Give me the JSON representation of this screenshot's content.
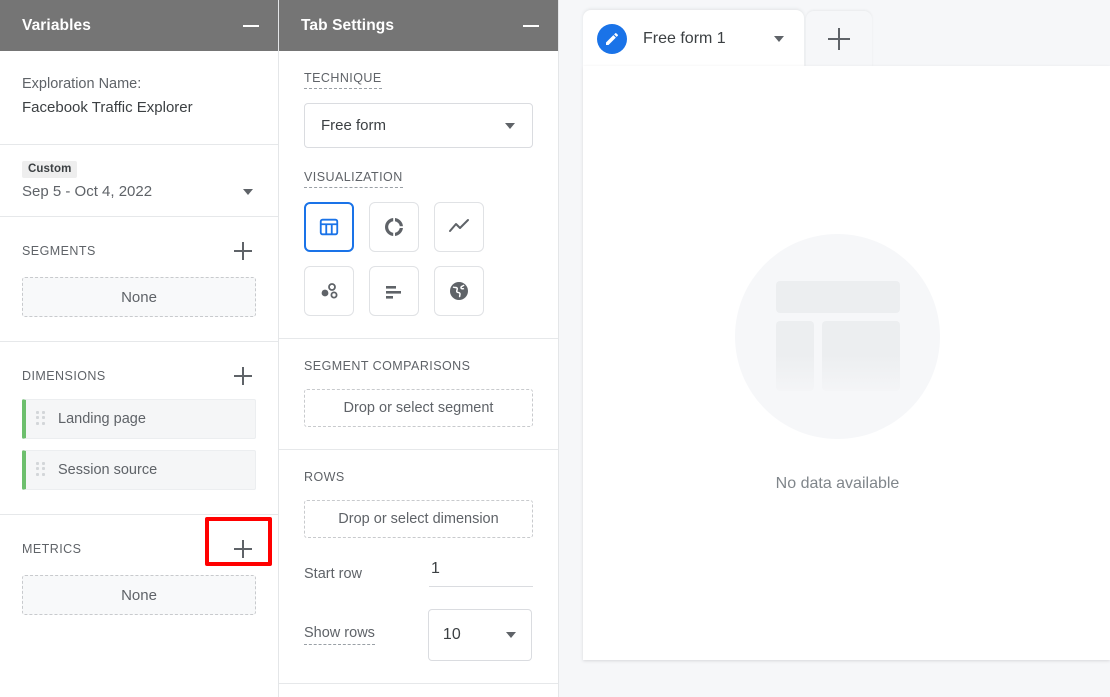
{
  "variables_panel": {
    "title": "Variables",
    "minimize_icon": "minimize-icon",
    "exploration": {
      "label": "Exploration Name:",
      "name": "Facebook Traffic Explorer"
    },
    "date_range": {
      "badge": "Custom",
      "value": "Sep 5 - Oct 4, 2022",
      "caret_icon": "chevron-down-icon"
    },
    "segments": {
      "title": "SEGMENTS",
      "add_icon": "plus-icon",
      "empty_label": "None"
    },
    "dimensions": {
      "title": "DIMENSIONS",
      "add_icon": "plus-icon",
      "items": [
        {
          "label": "Landing page",
          "handle_icon": "drag-handle-icon"
        },
        {
          "label": "Session source",
          "handle_icon": "drag-handle-icon"
        }
      ]
    },
    "metrics": {
      "title": "METRICS",
      "add_icon": "plus-icon",
      "empty_label": "None",
      "highlight_color": "#ff0000"
    }
  },
  "tab_settings_panel": {
    "title": "Tab Settings",
    "minimize_icon": "minimize-icon",
    "technique": {
      "label": "TECHNIQUE",
      "value": "Free form",
      "caret_icon": "chevron-down-icon"
    },
    "visualization": {
      "label": "VISUALIZATION",
      "options": [
        {
          "icon": "table-chart-icon",
          "selected": true
        },
        {
          "icon": "donut-chart-icon",
          "selected": false
        },
        {
          "icon": "line-chart-icon",
          "selected": false
        },
        {
          "icon": "scatter-plot-icon",
          "selected": false
        },
        {
          "icon": "bar-chart-icon",
          "selected": false
        },
        {
          "icon": "geo-map-icon",
          "selected": false
        }
      ],
      "selected_color": "#1a73e8"
    },
    "segment_comparisons": {
      "label": "SEGMENT COMPARISONS",
      "drop_label": "Drop or select segment"
    },
    "rows": {
      "label": "ROWS",
      "drop_label": "Drop or select dimension",
      "start_row_label": "Start row",
      "start_row_value": "1",
      "show_rows_label": "Show rows",
      "show_rows_value": "10",
      "caret_icon": "chevron-down-icon"
    }
  },
  "canvas": {
    "tabs": [
      {
        "label": "Free form 1",
        "icon": "edit-pencil-icon",
        "caret_icon": "chevron-down-icon"
      }
    ],
    "add_tab_icon": "plus-icon",
    "empty_state": {
      "illustration": "table-skeleton-illustration",
      "message": "No data available"
    }
  }
}
